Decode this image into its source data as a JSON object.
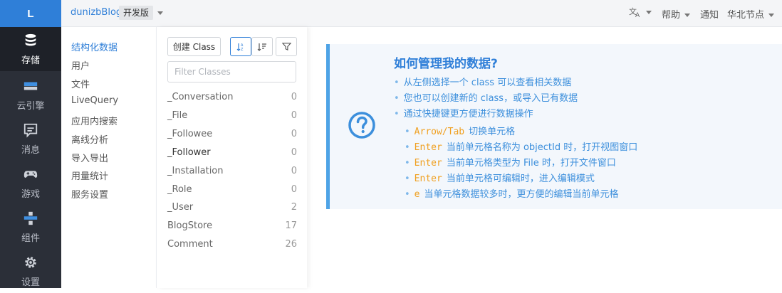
{
  "rail": {
    "logo": "L",
    "items": [
      {
        "label": "存储",
        "icon": "database-icon",
        "active": true
      },
      {
        "label": "云引擎",
        "icon": "server-icon"
      },
      {
        "label": "消息",
        "icon": "message-icon"
      },
      {
        "label": "游戏",
        "icon": "gamepad-icon"
      },
      {
        "label": "组件",
        "icon": "components-icon"
      },
      {
        "label": "设置",
        "icon": "gear-icon"
      }
    ]
  },
  "topbar": {
    "app_name": "dunizbBlog",
    "env": "开发版",
    "right": {
      "translate_icon": "translate-icon",
      "help": "帮助",
      "notify": "通知",
      "region": "华北节点"
    }
  },
  "subnav": {
    "items": [
      "结构化数据",
      "用户",
      "文件",
      "LiveQuery",
      "应用内搜索",
      "离线分析",
      "导入导出",
      "用量统计",
      "服务设置"
    ]
  },
  "classes": {
    "create_label": "创建 Class",
    "filter_placeholder": "Filter Classes",
    "rows": [
      {
        "name": "_Conversation",
        "count": "0"
      },
      {
        "name": "_File",
        "count": "0"
      },
      {
        "name": "_Followee",
        "count": "0"
      },
      {
        "name": "_Follower",
        "count": "0"
      },
      {
        "name": "_Installation",
        "count": "0"
      },
      {
        "name": "_Role",
        "count": "0"
      },
      {
        "name": "_User",
        "count": "2"
      },
      {
        "name": "BlogStore",
        "count": "17"
      },
      {
        "name": "Comment",
        "count": "26"
      }
    ]
  },
  "help": {
    "title": "如何管理我的数据?",
    "lines": [
      "从左侧选择一个 class 可以查看相关数据",
      "您也可以创建新的 class，或导入已有数据",
      "通过快捷键更方便进行数据操作"
    ],
    "shortcuts": [
      {
        "key": "Arrow/Tab",
        "text": "切换单元格"
      },
      {
        "key": "Enter",
        "text": "当前单元格名称为 objectId 时，打开视图窗口"
      },
      {
        "key": "Enter",
        "text": "当前单元格类型为 File 时，打开文件窗口"
      },
      {
        "key": "Enter",
        "text": "当前单元格可编辑时，进入编辑模式"
      },
      {
        "key": "e",
        "text": "当单元格数据较多时，更方便的编辑当前单元格"
      }
    ]
  },
  "colors": {
    "accent": "#2f7fd8",
    "rail": "#2b2f38",
    "shortcut_key": "#f0a020"
  }
}
